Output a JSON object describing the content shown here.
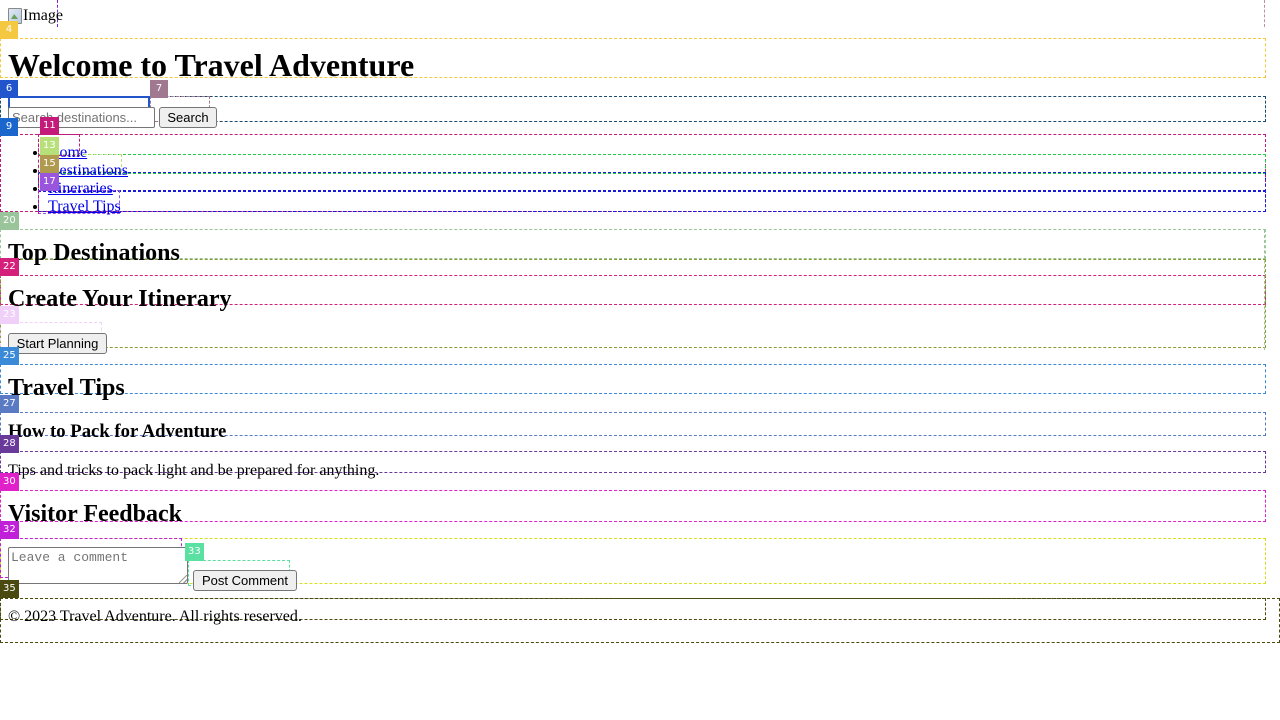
{
  "header": {
    "image_alt": "Image",
    "image_icon": "broken-image-icon",
    "title": "Welcome to Travel Adventure"
  },
  "search": {
    "placeholder": "Search destinations...",
    "value": "",
    "button_label": "Search"
  },
  "nav": {
    "items": [
      {
        "label": "Home"
      },
      {
        "label": "Destinations"
      },
      {
        "label": "Itineraries"
      },
      {
        "label": "Travel Tips"
      }
    ]
  },
  "sections": {
    "destinations": {
      "heading": "Top Destinations"
    },
    "itinerary": {
      "heading": "Create Your Itinerary",
      "button_label": "Start Planning"
    },
    "tips": {
      "heading": "Travel Tips",
      "article_title": "How to Pack for Adventure",
      "article_body": "Tips and tricks to pack light and be prepared for anything."
    },
    "feedback": {
      "heading": "Visitor Feedback",
      "comment_placeholder": "Leave a comment",
      "comment_value": "",
      "button_label": "Post Comment"
    }
  },
  "footer": {
    "text": "© 2023 Travel Adventure. All rights reserved."
  },
  "annotations": [
    {
      "label": "4",
      "color": "#f5c842"
    },
    {
      "label": "6",
      "color": "#2255cc"
    },
    {
      "label": "7",
      "color": "#a07890"
    },
    {
      "label": "9",
      "color": "#1a66cc"
    },
    {
      "label": "11",
      "color": "#c41a7a"
    },
    {
      "label": "13",
      "color": "#b8e07a"
    },
    {
      "label": "15",
      "color": "#b09a50"
    },
    {
      "label": "17",
      "color": "#9a55dd"
    },
    {
      "label": "20",
      "color": "#9ac49a"
    },
    {
      "label": "22",
      "color": "#d4207a"
    },
    {
      "label": "23",
      "color": "#f0d0f8"
    },
    {
      "label": "25",
      "color": "#3a8ad8"
    },
    {
      "label": "27",
      "color": "#5a7ac4"
    },
    {
      "label": "28",
      "color": "#6a3a9a"
    },
    {
      "label": "30",
      "color": "#e020c8"
    },
    {
      "label": "32",
      "color": "#c020d8"
    },
    {
      "label": "33",
      "color": "#5ae0a0"
    },
    {
      "label": "35",
      "color": "#4a4a10"
    }
  ]
}
